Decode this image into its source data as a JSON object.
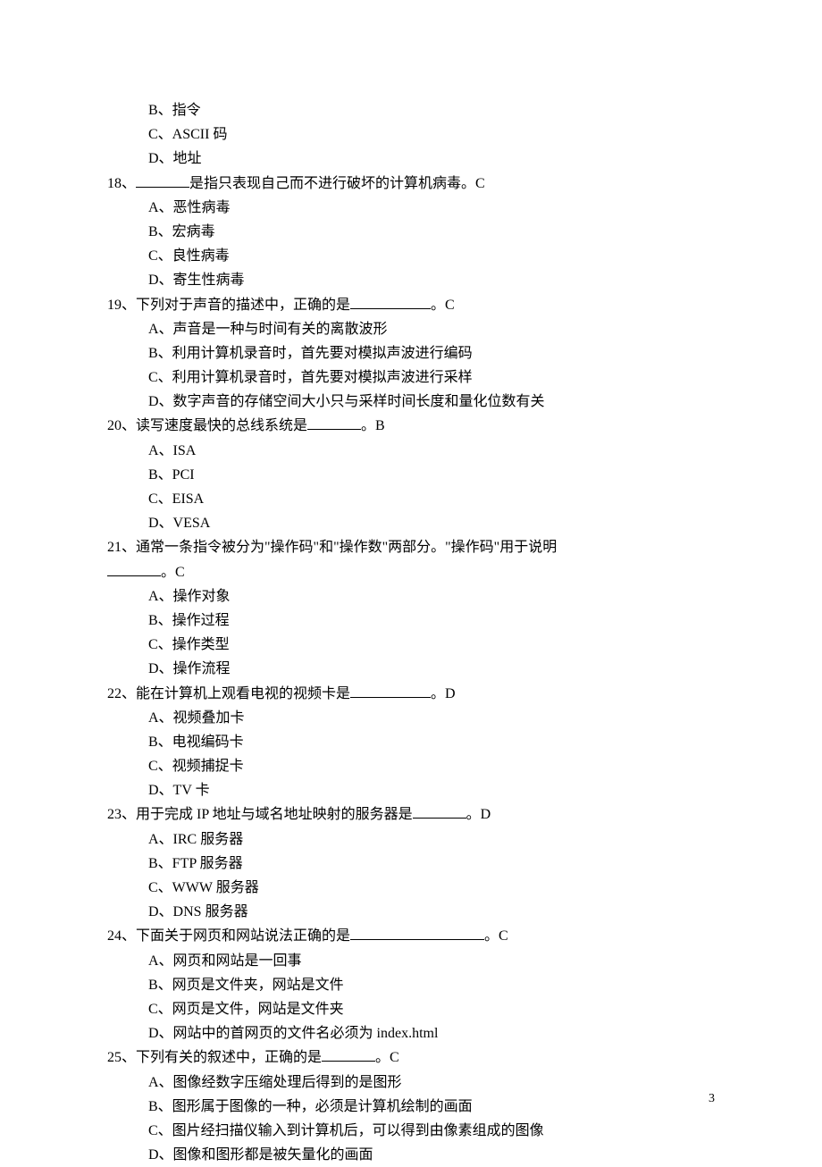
{
  "orphan_options": [
    "B、指令",
    "C、ASCII 码",
    "D、地址"
  ],
  "questions": [
    {
      "num": "18、",
      "blank": "short",
      "text_after": "是指只表现自己而不进行破坏的计算机病毒。",
      "answer": "C",
      "options": [
        "A、恶性病毒",
        "B、宏病毒",
        "C、良性病毒",
        "D、寄生性病毒"
      ]
    },
    {
      "num": "19、",
      "text_before": "下列对于声音的描述中，正确的是",
      "blank": "med",
      "text_after": "。",
      "answer": "C",
      "options": [
        "A、声音是一种与时间有关的离散波形",
        "B、利用计算机录音时，首先要对模拟声波进行编码",
        "C、利用计算机录音时，首先要对模拟声波进行采样",
        "D、数字声音的存储空间大小只与采样时间长度和量化位数有关"
      ]
    },
    {
      "num": "20、",
      "text_before": "读写速度最快的总线系统是",
      "blank": "short",
      "text_after": "。",
      "answer": "B",
      "options": [
        "A、ISA",
        "B、PCI",
        "C、EISA",
        "D、VESA"
      ]
    },
    {
      "num": "21、",
      "text_before": "通常一条指令被分为\"操作码\"和\"操作数\"两部分。\"操作码\"用于说明",
      "blank_line2": "short",
      "text_after2": "。",
      "answer": "C",
      "options": [
        "A、操作对象",
        "B、操作过程",
        "C、操作类型",
        "D、操作流程"
      ]
    },
    {
      "num": "22、",
      "text_before": "能在计算机上观看电视的视频卡是",
      "blank": "med",
      "text_after": "。",
      "answer": "D",
      "options": [
        "A、视频叠加卡",
        "B、电视编码卡",
        "C、视频捕捉卡",
        "D、TV 卡"
      ]
    },
    {
      "num": "23、",
      "text_before": "用于完成 IP 地址与域名地址映射的服务器是",
      "blank": "short",
      "text_after": "。",
      "answer": "D",
      "options": [
        "A、IRC 服务器",
        "B、FTP 服务器",
        "C、WWW 服务器",
        "D、DNS 服务器"
      ]
    },
    {
      "num": "24、",
      "text_before": "下面关于网页和网站说法正确的是",
      "blank": "long",
      "text_after": "。",
      "answer": "C",
      "options": [
        "A、网页和网站是一回事",
        "B、网页是文件夹，网站是文件",
        "C、网页是文件，网站是文件夹",
        "D、网站中的首网页的文件名必须为 index.html"
      ]
    },
    {
      "num": "25、",
      "text_before": "下列有关的叙述中，正确的是",
      "blank": "short",
      "text_after": "。",
      "answer": "C",
      "options": [
        "A、图像经数字压缩处理后得到的是图形",
        "B、图形属于图像的一种，必须是计算机绘制的画面",
        "C、图片经扫描仪输入到计算机后，可以得到由像素组成的图像",
        "D、图像和图形都是被矢量化的画面"
      ]
    }
  ],
  "page_number": "3"
}
